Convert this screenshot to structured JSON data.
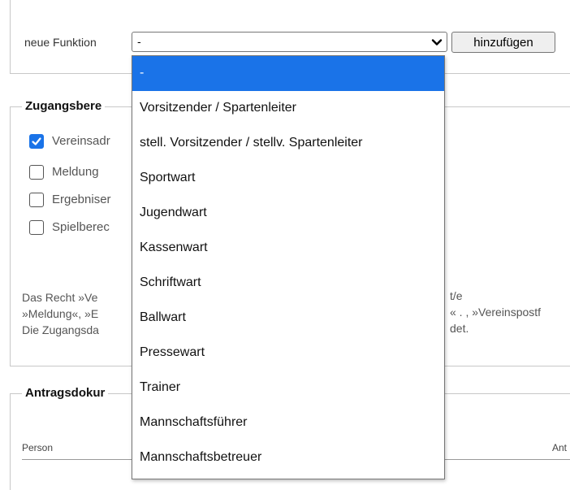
{
  "function_row": {
    "label": "neue Funktion",
    "select_value": "-",
    "add_button_label": "hinzufügen"
  },
  "access_section": {
    "legend": "Zugangsbere",
    "checkboxes": [
      {
        "label": "Vereinsadr",
        "checked": true
      },
      {
        "label": "Meldung",
        "checked": false
      },
      {
        "label": "Ergebniser",
        "checked": false
      },
      {
        "label": "Spielberec",
        "checked": false
      }
    ],
    "info_lines": [
      "Das Recht »Ve",
      "»Meldung«, »E",
      "Die Zugangsda"
    ],
    "info_right": [
      "t/e",
      "« . , »Vereinspostf",
      "det."
    ]
  },
  "documents_section": {
    "legend": "Antragsdokur",
    "col_person": "Person",
    "col_right": "Ant"
  },
  "dropdown": {
    "options": [
      "-",
      "Vorsitzender / Spartenleiter",
      "stell. Vorsitzender / stellv. Spartenleiter",
      "Sportwart",
      "Jugendwart",
      "Kassenwart",
      "Schriftwart",
      "Ballwart",
      "Pressewart",
      "Trainer",
      "Mannschaftsführer",
      "Mannschaftsbetreuer"
    ],
    "selected_index": 0
  },
  "colors": {
    "accent": "#1a73e8",
    "border": "#c8c8c8"
  },
  "icons": {
    "select_arrow": "chevron-down-icon",
    "checkmark": "checkmark-icon"
  }
}
